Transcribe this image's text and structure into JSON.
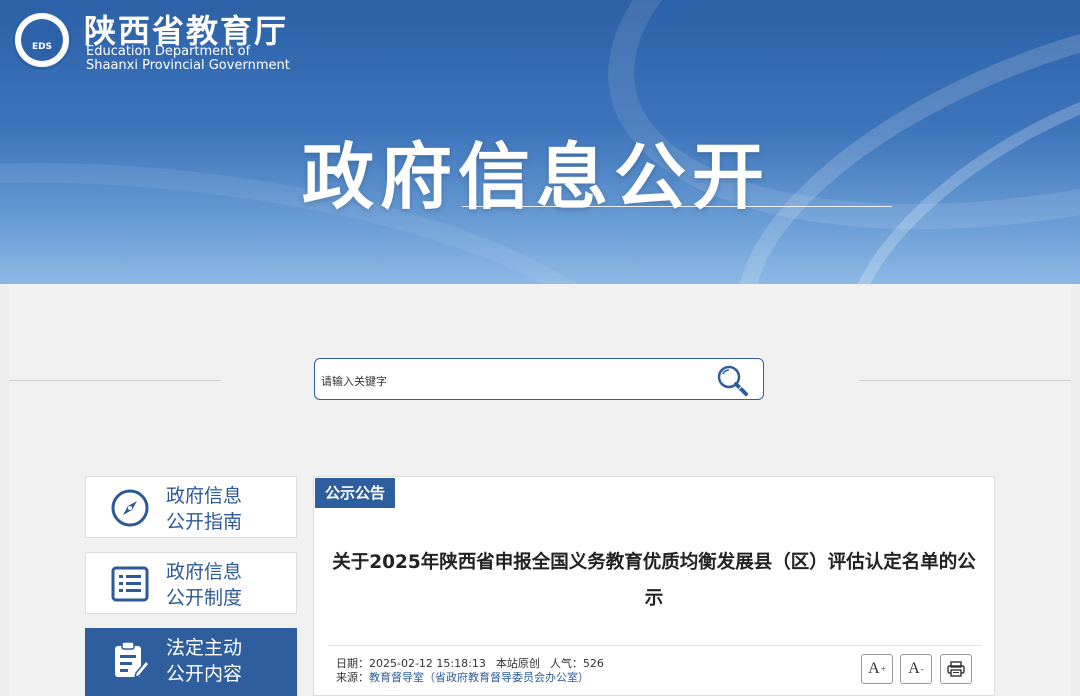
{
  "header": {
    "org_name_cn": "陕西省教育厅",
    "org_name_en_line1": "Education Department of",
    "org_name_en_line2": "Shaanxi Provincial Government",
    "logo_text": "EDS",
    "page_heading": "政府信息公开"
  },
  "search": {
    "placeholder": "请输入关键字"
  },
  "sidebar": {
    "items": [
      {
        "label": "政府信息\n公开指南",
        "icon": "compass-icon",
        "active": false
      },
      {
        "label": "政府信息\n公开制度",
        "icon": "list-icon",
        "active": false
      },
      {
        "label": "法定主动\n公开内容",
        "icon": "clipboard-edit-icon",
        "active": true
      }
    ]
  },
  "article": {
    "category": "公示公告",
    "title": "关于2025年陕西省申报全国义务教育优质均衡发展县（区）评估认定名单的公\n示",
    "meta": {
      "date_label": "日期：",
      "date_value": "2025-02-12 15:18:13",
      "origin": "本站原创",
      "views_label": "人气：",
      "views_value": "526",
      "source_label": "来源：",
      "source_value": "教育督导室（省政府教育督导委员会办公室）"
    },
    "tools": {
      "font_larger": "A",
      "font_larger_mark": "+",
      "font_smaller": "A",
      "font_smaller_mark": "-"
    }
  },
  "colors": {
    "primary": "#2e5e9e",
    "header_top": "#2c61a7",
    "header_bottom": "#8db8e4",
    "background": "#f1f1f1"
  }
}
